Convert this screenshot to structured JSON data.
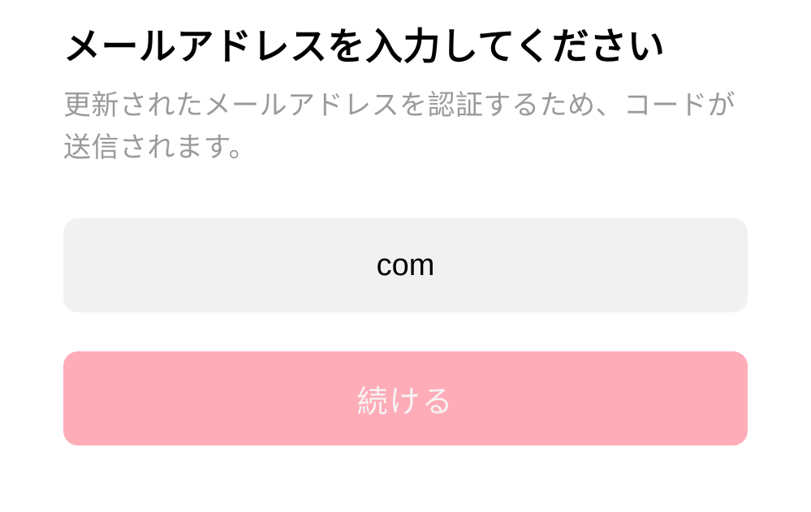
{
  "title": "メールアドレスを入力してください",
  "subtitle": "更新されたメールアドレスを認証するため、コードが送信されます。",
  "email_input": {
    "value": "com"
  },
  "continue_button": {
    "label": "続ける"
  }
}
